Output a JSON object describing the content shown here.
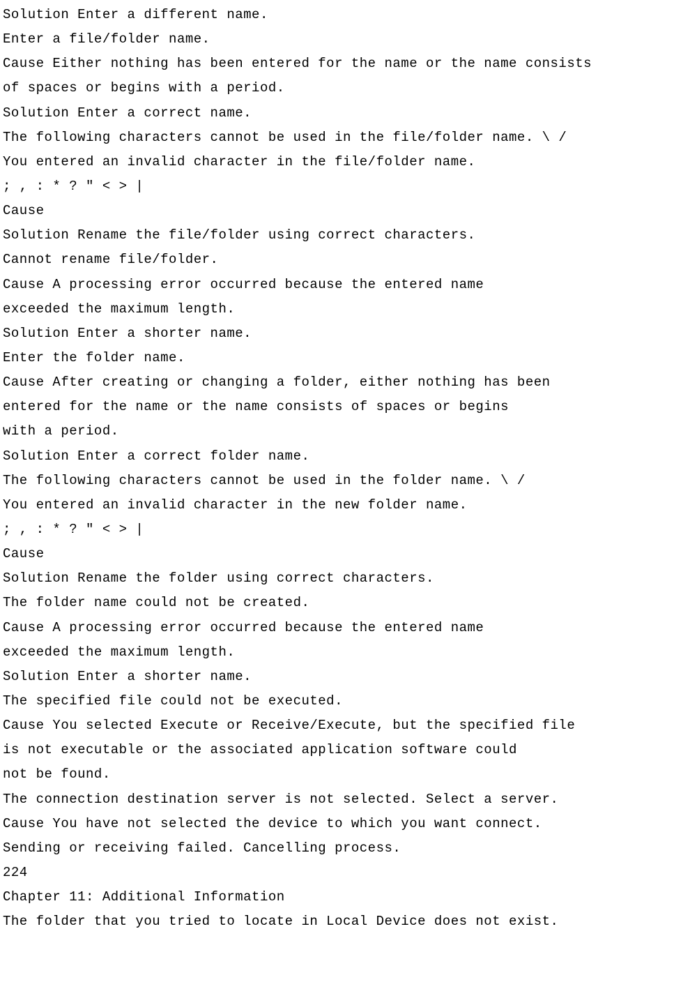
{
  "lines": [
    "Solution Enter a different name.",
    "Enter a file/folder name.",
    "Cause Either nothing has been entered for the name or the name consists",
    "of spaces or begins with a period.",
    "Solution Enter a correct name.",
    "The following characters cannot be used in the file/folder name. \\ /",
    "You entered an invalid character in the file/folder name.",
    "; , : * ? \" < > |",
    "Cause",
    "Solution Rename the file/folder using correct characters.",
    "Cannot rename file/folder.",
    "Cause A processing error occurred because the entered name",
    "exceeded the maximum length.",
    "Solution Enter a shorter name.",
    "Enter the folder name.",
    "Cause After creating or changing a folder, either nothing has been",
    "entered for the name or the name consists of spaces or begins",
    "with a period.",
    "Solution Enter a correct folder name.",
    "The following characters cannot be used in the folder name. \\ /",
    "You entered an invalid character in the new folder name.",
    "; , : * ? \" < > |",
    "Cause",
    "Solution Rename the folder using correct characters.",
    "The folder name could not be created.",
    "Cause A processing error occurred because the entered name",
    "exceeded the maximum length.",
    "Solution Enter a shorter name.",
    "The specified file could not be executed.",
    "Cause You selected Execute or Receive/Execute, but the specified file",
    "is not executable or the associated application software could",
    "not be found.",
    "The connection destination server is not selected. Select a server.",
    "Cause You have not selected the device to which you want connect.",
    "Sending or receiving failed. Cancelling process.",
    "224",
    "Chapter 11: Additional Information",
    "The folder that you tried to locate in Local Device does not exist."
  ]
}
